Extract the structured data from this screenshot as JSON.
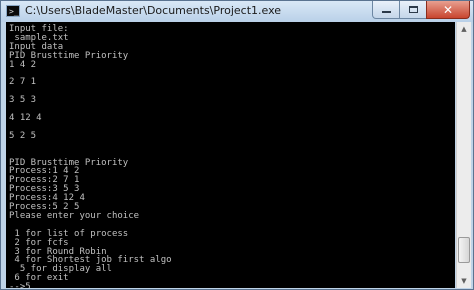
{
  "window": {
    "title": "C:\\Users\\BladeMaster\\Documents\\Project1.exe",
    "icon": "console-app-icon",
    "icon_glyph": ">_",
    "buttons": {
      "minimize_icon": "minimize-icon",
      "maximize_icon": "maximize-icon",
      "close_icon": "close-icon",
      "close_glyph": "✕"
    }
  },
  "console": {
    "lines": [
      "Input file:",
      " sample.txt",
      "Input data",
      "PID Brusttime Priority",
      "1 4 2",
      "",
      "2 7 1",
      "",
      "3 5 3",
      "",
      "4 12 4",
      "",
      "5 2 5",
      "",
      "",
      "PID Brusttime Priority",
      "Process:1 4 2",
      "Process:2 7 1",
      "Process:3 5 3",
      "Process:4 12 4",
      "Process:5 2 5",
      "Please enter your choice",
      "",
      " 1 for list of process",
      " 2 for fcfs",
      " 3 for Round Robin",
      " 4 for Shortest job first algo",
      "  5 for display all",
      " 6 for exit",
      "-->5"
    ]
  },
  "scrollbar": {
    "up_arrow": "▲",
    "down_arrow": "▼",
    "position": 0.95
  },
  "colors": {
    "console_background": "#000000",
    "console_text": "#c0c0c0",
    "close_button": "#c8452f"
  }
}
